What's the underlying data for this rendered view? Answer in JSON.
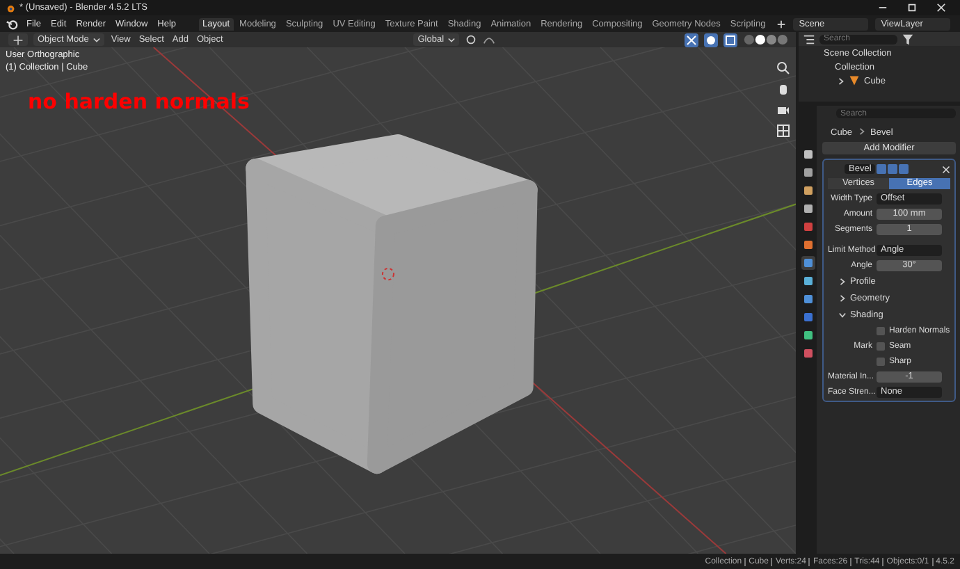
{
  "window": {
    "title": "* (Unsaved) - Blender 4.5.2 LTS"
  },
  "menu": [
    "File",
    "Edit",
    "Render",
    "Window",
    "Help"
  ],
  "workspaces": [
    {
      "label": "Layout",
      "selected": true
    },
    {
      "label": "Modeling",
      "selected": false
    },
    {
      "label": "Sculpting",
      "selected": false
    },
    {
      "label": "UV Editing",
      "selected": false
    },
    {
      "label": "Texture Paint",
      "selected": false
    },
    {
      "label": "Shading",
      "selected": false
    },
    {
      "label": "Animation",
      "selected": false
    },
    {
      "label": "Rendering",
      "selected": false
    },
    {
      "label": "Compositing",
      "selected": false
    },
    {
      "label": "Geometry Nodes",
      "selected": false
    },
    {
      "label": "Scripting",
      "selected": false
    }
  ],
  "scene": {
    "name": "Scene",
    "view_layer": "ViewLayer"
  },
  "viewport_header": {
    "mode": "Object Mode",
    "menus": [
      "View",
      "Select",
      "Add",
      "Object"
    ],
    "orientation": "Global"
  },
  "viewport": {
    "view_name": "User Orthographic",
    "collection_info": "(1) Collection | Cube",
    "annotation": "no harden normals"
  },
  "outliner": {
    "search_placeholder": "Search",
    "items": [
      {
        "label": "Scene Collection",
        "children": [
          {
            "label": "Collection",
            "children": [
              {
                "label": "Cube",
                "expanded": false
              }
            ]
          }
        ]
      }
    ]
  },
  "properties": {
    "search_placeholder": "Search",
    "property_tabs": [
      {
        "color": "#c0c0c0",
        "selected": false
      },
      {
        "color": "#a0a0a0",
        "selected": false
      },
      {
        "color": "#d0a060",
        "selected": false
      },
      {
        "color": "#b0b0b0",
        "selected": false
      },
      {
        "color": "#d04040",
        "selected": false
      },
      {
        "color": "#e07030",
        "selected": false
      },
      {
        "color": "#4f90d8",
        "selected": true
      },
      {
        "color": "#5ab0d8",
        "selected": false
      },
      {
        "color": "#4f90d8",
        "selected": false
      },
      {
        "color": "#3a70d0",
        "selected": false
      },
      {
        "color": "#40c080",
        "selected": false
      },
      {
        "color": "#d05060",
        "selected": false
      }
    ],
    "breadcrumb": [
      "Cube",
      "Bevel"
    ],
    "add_modifier": "Add Modifier",
    "modifier": {
      "name": "Bevel",
      "affect": [
        {
          "label": "Vertices",
          "selected": false
        },
        {
          "label": "Edges",
          "selected": true
        }
      ],
      "rows": [
        {
          "label": "Width Type",
          "value": "Offset",
          "kind": "dropdown"
        },
        {
          "label": "Amount",
          "value": "100 mm",
          "kind": "number"
        },
        {
          "label": "Segments",
          "value": "1",
          "kind": "number"
        },
        {
          "label": "Limit Method",
          "value": "Angle",
          "kind": "dropdown"
        },
        {
          "label": "Angle",
          "value": "30°",
          "kind": "number"
        }
      ],
      "subpanels": [
        {
          "label": "Profile",
          "expanded": false
        },
        {
          "label": "Geometry",
          "expanded": false
        },
        {
          "label": "Shading",
          "expanded": true
        }
      ],
      "shading": {
        "harden_normals": {
          "label": "Harden Normals",
          "checked": false
        },
        "mark_label": "Mark",
        "seam": {
          "label": "Seam",
          "checked": false
        },
        "sharp": {
          "label": "Sharp",
          "checked": false
        },
        "rows": [
          {
            "label": "Material In...",
            "value": "-1",
            "kind": "number"
          },
          {
            "label": "Face Stren...",
            "value": "None",
            "kind": "dropdown"
          }
        ]
      }
    }
  },
  "status_bar": [
    "Collection",
    "Cube",
    "Verts:24",
    "Faces:26",
    "Tris:44",
    "Objects:0/1",
    "4.5.2"
  ]
}
